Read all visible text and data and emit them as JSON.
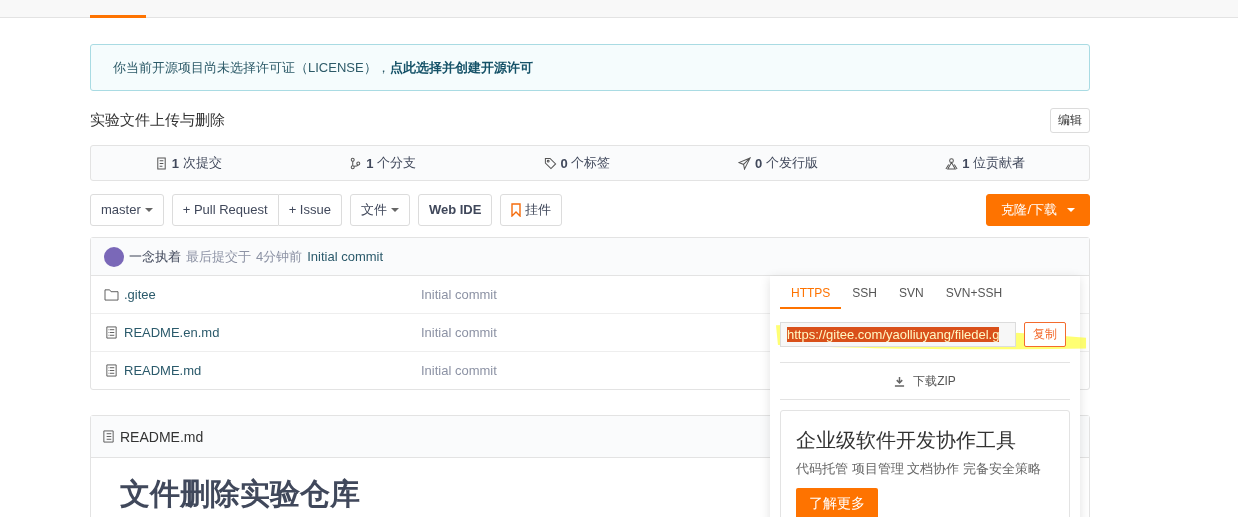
{
  "license_notice": {
    "text": "你当前开源项目尚未选择许可证（LICENSE），",
    "link": "点此选择并创建开源许可"
  },
  "repo": {
    "description": "实验文件上传与删除",
    "edit_button": "编辑"
  },
  "stats": [
    {
      "kind": "commits",
      "count": "1",
      "label": "次提交"
    },
    {
      "kind": "branches",
      "count": "1",
      "label": "个分支"
    },
    {
      "kind": "tags",
      "count": "0",
      "label": "个标签"
    },
    {
      "kind": "releases",
      "count": "0",
      "label": "个发行版"
    },
    {
      "kind": "contributors",
      "count": "1",
      "label": "位贡献者"
    }
  ],
  "toolbar": {
    "branch": "master",
    "pull_request": "+ Pull Request",
    "issue": "+ Issue",
    "files": "文件",
    "web_ide": "Web IDE",
    "widget": "挂件",
    "clone": "克隆/下载"
  },
  "last_commit": {
    "author": "一念执着",
    "meta": "最后提交于",
    "time": "4分钟前",
    "message": "Initial commit"
  },
  "files": [
    {
      "kind": "folder",
      "name": ".gitee",
      "commit": "Initial commit"
    },
    {
      "kind": "file",
      "name": "README.en.md",
      "commit": "Initial commit"
    },
    {
      "kind": "file",
      "name": "README.md",
      "commit": "Initial commit"
    }
  ],
  "clone_panel": {
    "tabs": [
      {
        "label": "HTTPS",
        "selected": true
      },
      {
        "label": "SSH",
        "selected": false
      },
      {
        "label": "SVN",
        "selected": false
      },
      {
        "label": "SVN+SSH",
        "selected": false
      }
    ],
    "url": "https://gitee.com/yaolliuyang/filedel.g",
    "copy_button": "复制",
    "download": "下载ZIP",
    "promo": {
      "title": "企业级软件开发协作工具",
      "subtitle": "代码托管 项目管理 文档协作 完备安全策略",
      "button": "了解更多"
    }
  },
  "readme": {
    "filename": "README.md",
    "heading": "文件删除实验仓库"
  }
}
